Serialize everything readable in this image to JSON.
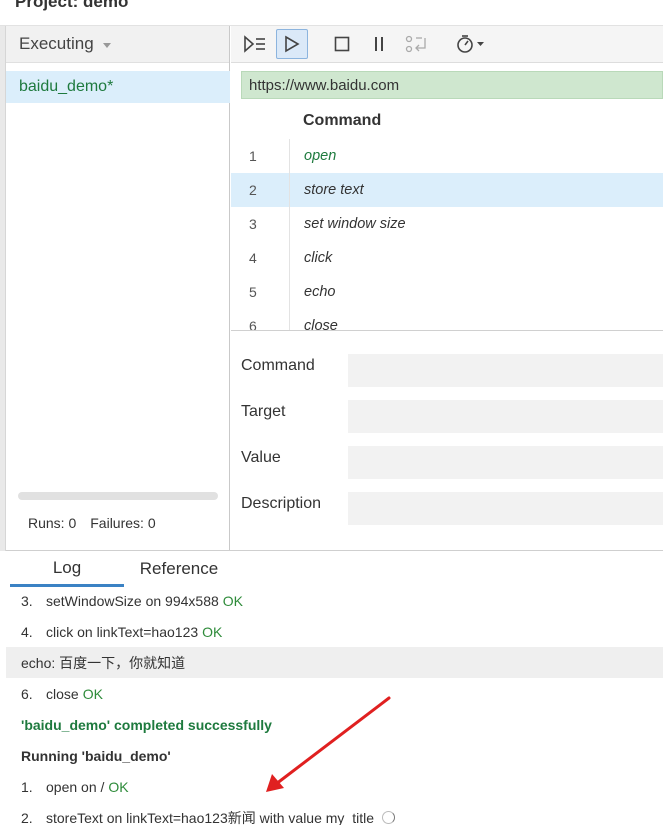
{
  "project": {
    "title": "Project:  demo"
  },
  "suites": {
    "dropdown_label": "Executing",
    "tests": [
      {
        "name": "baidu_demo*"
      }
    ],
    "runs_label": "Runs: 0",
    "failures_label": "Failures: 0"
  },
  "toolbar": {
    "buttons": [
      "run-all-icon",
      "run-icon",
      "stop-icon",
      "pause-icon",
      "step-icon",
      "timer-icon"
    ]
  },
  "editor": {
    "base_url": "https://www.baidu.com",
    "command_header": "Command",
    "commands": [
      {
        "num": "1",
        "name": "open"
      },
      {
        "num": "2",
        "name": "store text"
      },
      {
        "num": "3",
        "name": "set window size"
      },
      {
        "num": "4",
        "name": "click"
      },
      {
        "num": "5",
        "name": "echo"
      },
      {
        "num": "6",
        "name": "close"
      }
    ],
    "selected_index": 1,
    "form": {
      "command_label": "Command",
      "target_label": "Target",
      "value_label": "Value",
      "description_label": "Description"
    }
  },
  "bottom": {
    "tabs": [
      "Log",
      "Reference"
    ],
    "active_tab": "Log",
    "log": {
      "row1_idx": "3.",
      "row1_text": "setWindowSize on 994x588",
      "row1_status": "OK",
      "row2_idx": "4.",
      "row2_text": "click on linkText=hao123",
      "row2_status": "OK",
      "row3_text": "echo: 百度一下，你就知道",
      "row4_idx": "6.",
      "row4_text": "close",
      "row4_status": "OK",
      "row5_text": "'baidu_demo' completed successfully",
      "row6_text": "Running 'baidu_demo'",
      "row7_idx": "1.",
      "row7_text": "open on /",
      "row7_status": "OK",
      "row8_idx": "2.",
      "row8_text": "storeText on linkText=hao123新闻 with value my_title"
    }
  },
  "colors": {
    "accent": "#3b82c4",
    "ok": "#2e8b3a",
    "annotation": "#e02020"
  }
}
